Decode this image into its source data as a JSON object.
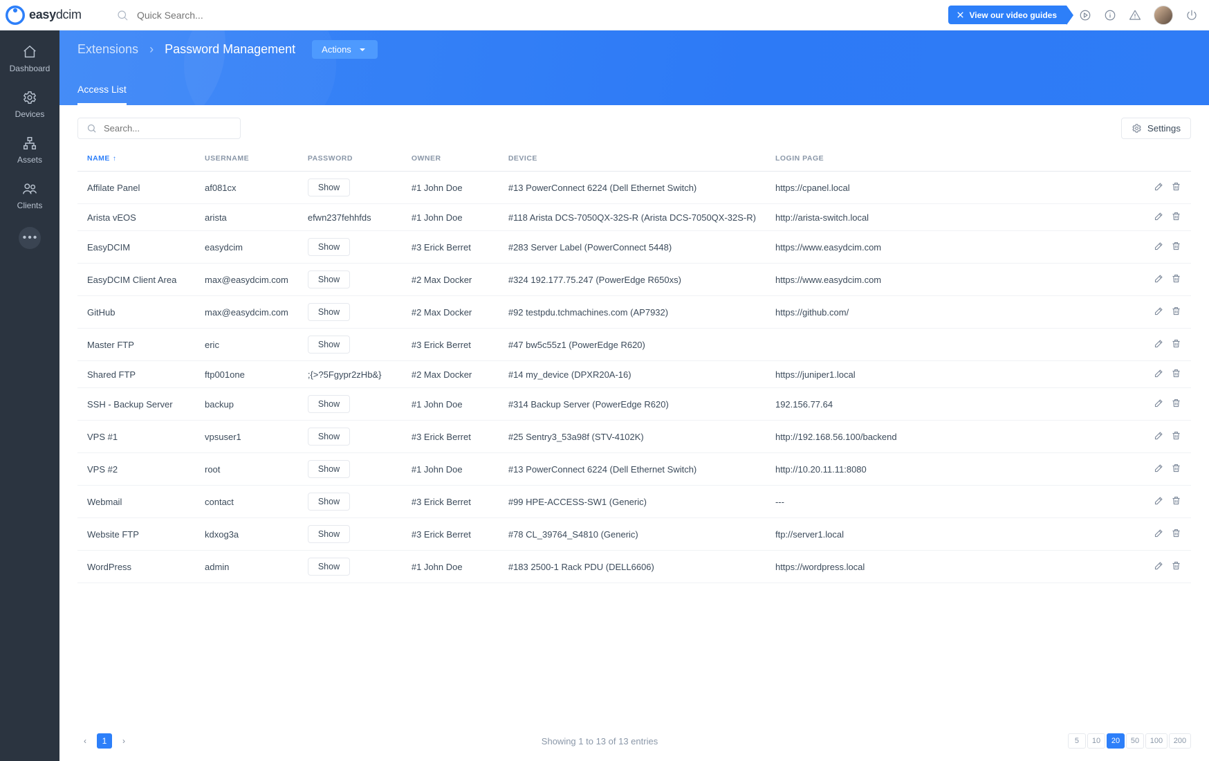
{
  "brand": {
    "name_pre": "easy",
    "name_post": "dcim"
  },
  "top": {
    "search_placeholder": "Quick Search...",
    "video_guides": "View our video guides"
  },
  "sidebar": {
    "items": [
      {
        "label": "Dashboard",
        "icon": "home-icon"
      },
      {
        "label": "Devices",
        "icon": "gear-icon"
      },
      {
        "label": "Assets",
        "icon": "hierarchy-icon"
      },
      {
        "label": "Clients",
        "icon": "people-icon"
      }
    ]
  },
  "header": {
    "crumb1": "Extensions",
    "crumb2": "Password Management",
    "actions": "Actions",
    "tab": "Access List"
  },
  "toolbar": {
    "search_placeholder": "Search...",
    "settings": "Settings"
  },
  "columns": {
    "name": "NAME",
    "username": "USERNAME",
    "password": "PASSWORD",
    "owner": "OWNER",
    "device": "DEVICE",
    "login": "LOGIN PAGE"
  },
  "show_label": "Show",
  "rows": [
    {
      "name": "Affilate Panel",
      "username": "af081cx",
      "password": "",
      "owner": "#1 John Doe",
      "device": "#13 PowerConnect 6224 (Dell Ethernet Switch)",
      "login": "https://cpanel.local"
    },
    {
      "name": "Arista vEOS",
      "username": "arista",
      "password": "efwn237fehhfds",
      "owner": "#1 John Doe",
      "device": "#118 Arista DCS-7050QX-32S-R (Arista DCS-7050QX-32S-R)",
      "login": "http://arista-switch.local"
    },
    {
      "name": "EasyDCIM",
      "username": "easydcim",
      "password": "",
      "owner": "#3 Erick Berret",
      "device": "#283 Server Label (PowerConnect 5448)",
      "login": "https://www.easydcim.com"
    },
    {
      "name": "EasyDCIM Client Area",
      "username": "max@easydcim.com",
      "password": "",
      "owner": "#2 Max Docker",
      "device": "#324 192.177.75.247 (PowerEdge R650xs)",
      "login": "https://www.easydcim.com"
    },
    {
      "name": "GitHub",
      "username": "max@easydcim.com",
      "password": "",
      "owner": "#2 Max Docker",
      "device": "#92 testpdu.tchmachines.com (AP7932)",
      "login": "https://github.com/"
    },
    {
      "name": "Master FTP",
      "username": "eric",
      "password": "",
      "owner": "#3 Erick Berret",
      "device": "#47 bw5c55z1 (PowerEdge R620)",
      "login": ""
    },
    {
      "name": "Shared FTP",
      "username": "ftp001one",
      "password": ";{>?5Fgypr2zHb&}",
      "owner": "#2 Max Docker",
      "device": "#14 my_device (DPXR20A-16)",
      "login": "https://juniper1.local"
    },
    {
      "name": "SSH - Backup Server",
      "username": "backup",
      "password": "",
      "owner": "#1 John Doe",
      "device": "#314 Backup Server (PowerEdge R620)",
      "login": "192.156.77.64"
    },
    {
      "name": "VPS #1",
      "username": "vpsuser1",
      "password": "",
      "owner": "#3 Erick Berret",
      "device": "#25 Sentry3_53a98f (STV-4102K)",
      "login": "http://192.168.56.100/backend"
    },
    {
      "name": "VPS #2",
      "username": "root",
      "password": "",
      "owner": "#1 John Doe",
      "device": "#13 PowerConnect 6224 (Dell Ethernet Switch)",
      "login": "http://10.20.11.11:8080"
    },
    {
      "name": "Webmail",
      "username": "contact",
      "password": "",
      "owner": "#3 Erick Berret",
      "device": "#99 HPE-ACCESS-SW1 (Generic)",
      "login": "---"
    },
    {
      "name": "Website FTP",
      "username": "kdxog3a",
      "password": "",
      "owner": "#3 Erick Berret",
      "device": "#78 CL_39764_S4810 (Generic)",
      "login": "ftp://server1.local"
    },
    {
      "name": "WordPress",
      "username": "admin",
      "password": "",
      "owner": "#1 John Doe",
      "device": "#183 2500-1 Rack PDU (DELL6606)",
      "login": "https://wordpress.local"
    }
  ],
  "pager": {
    "current": "1",
    "summary": "Showing 1 to 13 of 13 entries",
    "sizes": [
      "5",
      "10",
      "20",
      "50",
      "100",
      "200"
    ],
    "active_size": "20"
  }
}
